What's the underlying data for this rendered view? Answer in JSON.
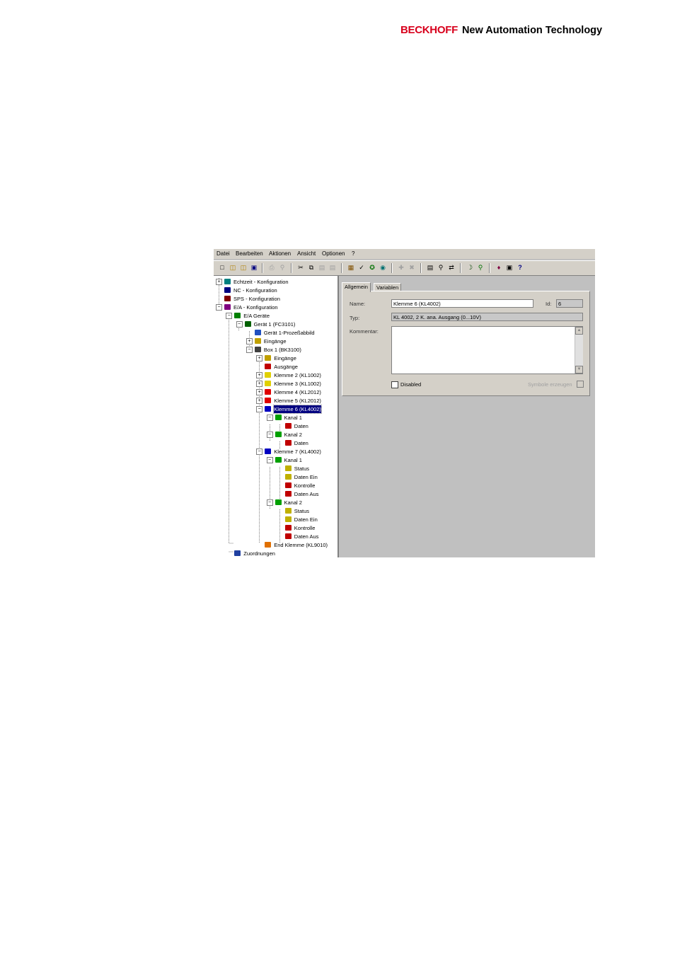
{
  "brand": {
    "name": "BECKHOFF",
    "tagline": "New Automation Technology",
    "color": "#d8001c"
  },
  "menu": [
    "Datei",
    "Bearbeiten",
    "Aktionen",
    "Ansicht",
    "Optionen",
    "?"
  ],
  "toolbar_icons": [
    "new-icon",
    "open-icon",
    "open-folder-icon",
    "save-icon",
    "print-icon",
    "print-preview-icon",
    "cut-icon",
    "copy-icon",
    "paste-icon",
    "paste-special-icon",
    "activate-config-icon",
    "check-icon",
    "run-mode-icon",
    "choose-target-icon",
    "add-icon",
    "delete-icon",
    "properties-icon",
    "search-icon",
    "goto-icon",
    "network-icon",
    "scan-icon",
    "book-icon",
    "info-icon",
    "help-icon"
  ],
  "tree": [
    {
      "label": "Echtzeit - Konfiguration",
      "exp": "+",
      "icon": "realtime-config-icon"
    },
    {
      "label": "NC - Konfiguration",
      "exp": "",
      "icon": "nc-config-icon"
    },
    {
      "label": "SPS - Konfiguration",
      "exp": "",
      "icon": "plc-config-icon"
    },
    {
      "label": "E/A - Konfiguration",
      "exp": "-",
      "icon": "io-config-icon"
    },
    {
      "label": "E/A Geräte",
      "exp": "-",
      "icon": "io-devices-icon"
    },
    {
      "label": "Gerät 1 (FC3101)",
      "exp": "-",
      "icon": "device-icon"
    },
    {
      "label": "Gerät 1-Prozeßabbild",
      "exp": "",
      "icon": "process-image-icon"
    },
    {
      "label": "Eingänge",
      "exp": "+",
      "icon": "inputs-icon"
    },
    {
      "label": "Box 1 (BK3100)",
      "exp": "-",
      "icon": "box-icon"
    },
    {
      "label": "Eingänge",
      "exp": "+",
      "icon": "inputs-icon"
    },
    {
      "label": "Ausgänge",
      "exp": "",
      "icon": "outputs-icon"
    },
    {
      "label": "Klemme 2 (KL1002)",
      "exp": "+",
      "icon": "terminal-yellow-icon"
    },
    {
      "label": "Klemme 3 (KL1002)",
      "exp": "+",
      "icon": "terminal-yellow-icon"
    },
    {
      "label": "Klemme 4 (KL2012)",
      "exp": "+",
      "icon": "terminal-red-icon"
    },
    {
      "label": "Klemme 5 (KL2012)",
      "exp": "+",
      "icon": "terminal-red-icon"
    },
    {
      "label": "Klemme 6 (KL4002)",
      "exp": "-",
      "icon": "terminal-blue-icon",
      "selected": true
    },
    {
      "label": "Kanal 1",
      "exp": "-",
      "icon": "channel-icon"
    },
    {
      "label": "Daten",
      "exp": "",
      "icon": "output-var-icon"
    },
    {
      "label": "Kanal 2",
      "exp": "-",
      "icon": "channel-icon"
    },
    {
      "label": "Daten",
      "exp": "",
      "icon": "output-var-icon"
    },
    {
      "label": "Klemme 7 (KL4002)",
      "exp": "-",
      "icon": "terminal-blue-icon"
    },
    {
      "label": "Kanal 1",
      "exp": "-",
      "icon": "channel-icon"
    },
    {
      "label": "Status",
      "exp": "",
      "icon": "input-var-icon"
    },
    {
      "label": "Daten Ein",
      "exp": "",
      "icon": "input-var-icon"
    },
    {
      "label": "Kontrolle",
      "exp": "",
      "icon": "output-var-icon"
    },
    {
      "label": "Daten Aus",
      "exp": "",
      "icon": "output-var-icon"
    },
    {
      "label": "Kanal 2",
      "exp": "-",
      "icon": "channel-icon"
    },
    {
      "label": "Status",
      "exp": "",
      "icon": "input-var-icon"
    },
    {
      "label": "Daten Ein",
      "exp": "",
      "icon": "input-var-icon"
    },
    {
      "label": "Kontrolle",
      "exp": "",
      "icon": "output-var-icon"
    },
    {
      "label": "Daten Aus",
      "exp": "",
      "icon": "output-var-icon"
    },
    {
      "label": "End Klemme (KL9010)",
      "exp": "",
      "icon": "end-terminal-icon"
    },
    {
      "label": "Zuordnungen",
      "exp": "",
      "icon": "mappings-icon"
    }
  ],
  "tabs": [
    "Allgemein",
    "Variablen"
  ],
  "form": {
    "name_label": "Name:",
    "name_value": "Klemme 6 (KL4002)",
    "id_label": "Id:",
    "id_value": "6",
    "type_label": "Typ:",
    "type_value": "KL 4002, 2 K. ana. Ausgang (0...10V)",
    "comment_label": "Kommentar:",
    "comment_value": "",
    "disabled_label": "Disabled",
    "symbols_label": "Symbole erzeugen"
  }
}
